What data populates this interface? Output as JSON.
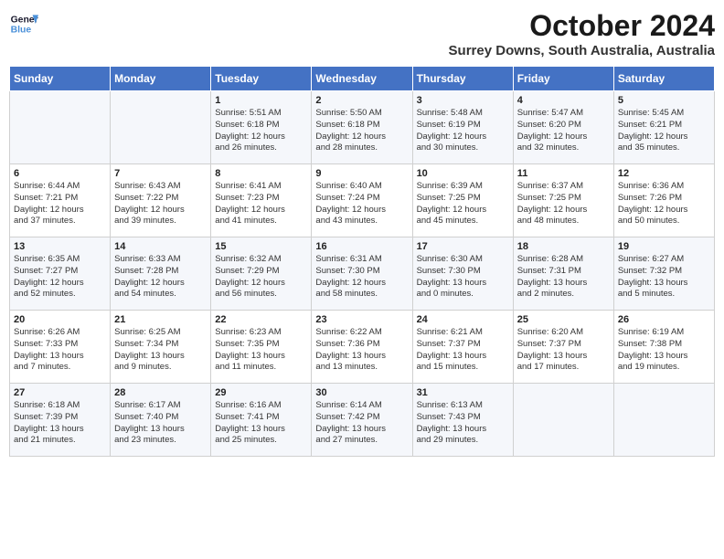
{
  "header": {
    "logo_line1": "General",
    "logo_line2": "Blue",
    "main_title": "October 2024",
    "subtitle": "Surrey Downs, South Australia, Australia"
  },
  "weekdays": [
    "Sunday",
    "Monday",
    "Tuesday",
    "Wednesday",
    "Thursday",
    "Friday",
    "Saturday"
  ],
  "weeks": [
    [
      {
        "day": "",
        "content": ""
      },
      {
        "day": "",
        "content": ""
      },
      {
        "day": "1",
        "content": "Sunrise: 5:51 AM\nSunset: 6:18 PM\nDaylight: 12 hours\nand 26 minutes."
      },
      {
        "day": "2",
        "content": "Sunrise: 5:50 AM\nSunset: 6:18 PM\nDaylight: 12 hours\nand 28 minutes."
      },
      {
        "day": "3",
        "content": "Sunrise: 5:48 AM\nSunset: 6:19 PM\nDaylight: 12 hours\nand 30 minutes."
      },
      {
        "day": "4",
        "content": "Sunrise: 5:47 AM\nSunset: 6:20 PM\nDaylight: 12 hours\nand 32 minutes."
      },
      {
        "day": "5",
        "content": "Sunrise: 5:45 AM\nSunset: 6:21 PM\nDaylight: 12 hours\nand 35 minutes."
      }
    ],
    [
      {
        "day": "6",
        "content": "Sunrise: 6:44 AM\nSunset: 7:21 PM\nDaylight: 12 hours\nand 37 minutes."
      },
      {
        "day": "7",
        "content": "Sunrise: 6:43 AM\nSunset: 7:22 PM\nDaylight: 12 hours\nand 39 minutes."
      },
      {
        "day": "8",
        "content": "Sunrise: 6:41 AM\nSunset: 7:23 PM\nDaylight: 12 hours\nand 41 minutes."
      },
      {
        "day": "9",
        "content": "Sunrise: 6:40 AM\nSunset: 7:24 PM\nDaylight: 12 hours\nand 43 minutes."
      },
      {
        "day": "10",
        "content": "Sunrise: 6:39 AM\nSunset: 7:25 PM\nDaylight: 12 hours\nand 45 minutes."
      },
      {
        "day": "11",
        "content": "Sunrise: 6:37 AM\nSunset: 7:25 PM\nDaylight: 12 hours\nand 48 minutes."
      },
      {
        "day": "12",
        "content": "Sunrise: 6:36 AM\nSunset: 7:26 PM\nDaylight: 12 hours\nand 50 minutes."
      }
    ],
    [
      {
        "day": "13",
        "content": "Sunrise: 6:35 AM\nSunset: 7:27 PM\nDaylight: 12 hours\nand 52 minutes."
      },
      {
        "day": "14",
        "content": "Sunrise: 6:33 AM\nSunset: 7:28 PM\nDaylight: 12 hours\nand 54 minutes."
      },
      {
        "day": "15",
        "content": "Sunrise: 6:32 AM\nSunset: 7:29 PM\nDaylight: 12 hours\nand 56 minutes."
      },
      {
        "day": "16",
        "content": "Sunrise: 6:31 AM\nSunset: 7:30 PM\nDaylight: 12 hours\nand 58 minutes."
      },
      {
        "day": "17",
        "content": "Sunrise: 6:30 AM\nSunset: 7:30 PM\nDaylight: 13 hours\nand 0 minutes."
      },
      {
        "day": "18",
        "content": "Sunrise: 6:28 AM\nSunset: 7:31 PM\nDaylight: 13 hours\nand 2 minutes."
      },
      {
        "day": "19",
        "content": "Sunrise: 6:27 AM\nSunset: 7:32 PM\nDaylight: 13 hours\nand 5 minutes."
      }
    ],
    [
      {
        "day": "20",
        "content": "Sunrise: 6:26 AM\nSunset: 7:33 PM\nDaylight: 13 hours\nand 7 minutes."
      },
      {
        "day": "21",
        "content": "Sunrise: 6:25 AM\nSunset: 7:34 PM\nDaylight: 13 hours\nand 9 minutes."
      },
      {
        "day": "22",
        "content": "Sunrise: 6:23 AM\nSunset: 7:35 PM\nDaylight: 13 hours\nand 11 minutes."
      },
      {
        "day": "23",
        "content": "Sunrise: 6:22 AM\nSunset: 7:36 PM\nDaylight: 13 hours\nand 13 minutes."
      },
      {
        "day": "24",
        "content": "Sunrise: 6:21 AM\nSunset: 7:37 PM\nDaylight: 13 hours\nand 15 minutes."
      },
      {
        "day": "25",
        "content": "Sunrise: 6:20 AM\nSunset: 7:37 PM\nDaylight: 13 hours\nand 17 minutes."
      },
      {
        "day": "26",
        "content": "Sunrise: 6:19 AM\nSunset: 7:38 PM\nDaylight: 13 hours\nand 19 minutes."
      }
    ],
    [
      {
        "day": "27",
        "content": "Sunrise: 6:18 AM\nSunset: 7:39 PM\nDaylight: 13 hours\nand 21 minutes."
      },
      {
        "day": "28",
        "content": "Sunrise: 6:17 AM\nSunset: 7:40 PM\nDaylight: 13 hours\nand 23 minutes."
      },
      {
        "day": "29",
        "content": "Sunrise: 6:16 AM\nSunset: 7:41 PM\nDaylight: 13 hours\nand 25 minutes."
      },
      {
        "day": "30",
        "content": "Sunrise: 6:14 AM\nSunset: 7:42 PM\nDaylight: 13 hours\nand 27 minutes."
      },
      {
        "day": "31",
        "content": "Sunrise: 6:13 AM\nSunset: 7:43 PM\nDaylight: 13 hours\nand 29 minutes."
      },
      {
        "day": "",
        "content": ""
      },
      {
        "day": "",
        "content": ""
      }
    ]
  ]
}
